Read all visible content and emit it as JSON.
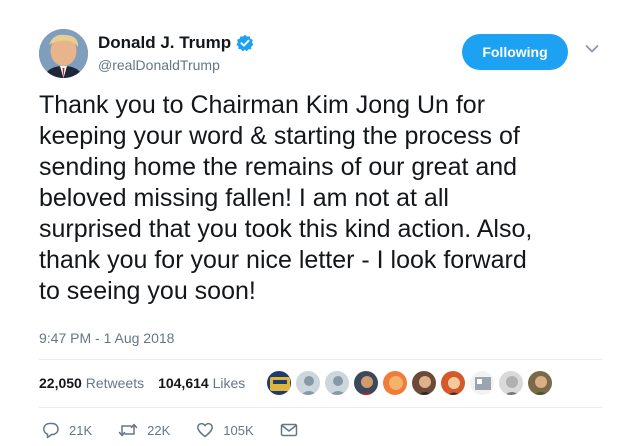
{
  "author": {
    "name": "Donald J. Trump",
    "handle": "@realDonaldTrump",
    "avatar_icon": "profile-photo",
    "verified_icon": "verified-badge-icon"
  },
  "follow_button": {
    "label": "Following"
  },
  "menu": {
    "icon": "chevron-down-icon"
  },
  "tweet": {
    "text": "Thank you to Chairman Kim Jong Un for\nkeeping your word & starting the process of\nsending home the remains of our great and\nbeloved missing fallen! I am not at all\nsurprised that you took this kind action. Also,\nthank you for your nice letter - I look forward\nto seeing you soon!",
    "timestamp": "9:47 PM - 1 Aug 2018"
  },
  "stats": {
    "retweets_count": "22,050",
    "retweets_label": "Retweets",
    "likes_count": "104,614",
    "likes_label": "Likes"
  },
  "actions": {
    "reply_count": "21K",
    "retweet_count": "22K",
    "like_count": "105K"
  },
  "colors": {
    "accent": "#1da1f2",
    "text": "#14171a",
    "muted": "#657786",
    "divider": "#e6ecf0"
  }
}
